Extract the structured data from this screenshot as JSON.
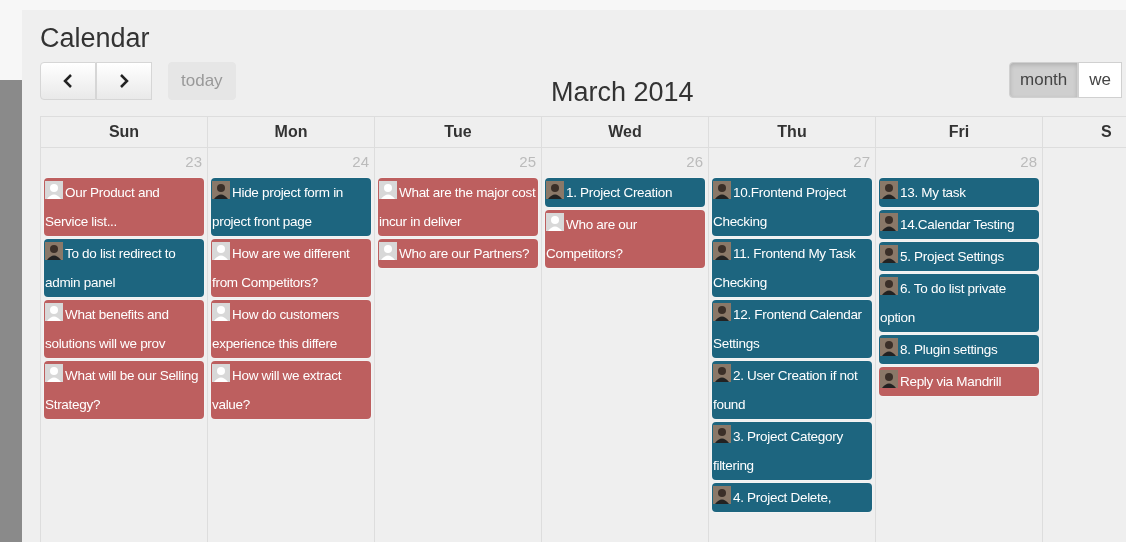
{
  "page": {
    "title": "Calendar"
  },
  "toolbar": {
    "today": "today",
    "title": "March 2014",
    "views": [
      {
        "label": "month",
        "selected": true
      },
      {
        "label": "we",
        "selected": false
      }
    ]
  },
  "days": [
    {
      "name": "Sun",
      "number": "23",
      "events": [
        {
          "text": "Our Product and Service list...",
          "color": "#bd5f5f",
          "kind": "generic"
        },
        {
          "text": "To do list redirect to admin panel",
          "color": "#1d657f",
          "kind": "photo"
        },
        {
          "text": "What benefits and solutions will we prov",
          "color": "#bd5f5f",
          "kind": "generic"
        },
        {
          "text": "What will be our Selling Strategy?",
          "color": "#bd5f5f",
          "kind": "generic"
        }
      ]
    },
    {
      "name": "Mon",
      "number": "24",
      "events": [
        {
          "text": "Hide project form in project front page",
          "color": "#1d657f",
          "kind": "photo"
        },
        {
          "text": "How are we different from Competitors?",
          "color": "#bd5f5f",
          "kind": "generic"
        },
        {
          "text": "How do customers experience this differe",
          "color": "#bd5f5f",
          "kind": "generic"
        },
        {
          "text": "How will we extract value?",
          "color": "#bd5f5f",
          "kind": "generic"
        }
      ]
    },
    {
      "name": "Tue",
      "number": "25",
      "events": [
        {
          "text": "What are the major cost incur in deliver",
          "color": "#bd5f5f",
          "kind": "generic"
        },
        {
          "text": "Who are our Partners?",
          "color": "#bd5f5f",
          "kind": "generic"
        }
      ]
    },
    {
      "name": "Wed",
      "number": "26",
      "events": [
        {
          "text": "1. Project Creation",
          "color": "#1d657f",
          "kind": "photo"
        },
        {
          "text": "Who are our Competitors?",
          "color": "#bd5f5f",
          "kind": "generic"
        }
      ]
    },
    {
      "name": "Thu",
      "number": "27",
      "events": [
        {
          "text": "10.Frontend Project Checking",
          "color": "#1d657f",
          "kind": "photo"
        },
        {
          "text": "11. Frontend My Task Checking",
          "color": "#1d657f",
          "kind": "photo"
        },
        {
          "text": "12. Frontend Calendar Settings",
          "color": "#1d657f",
          "kind": "photo"
        },
        {
          "text": "2. User Creation if not found",
          "color": "#1d657f",
          "kind": "photo"
        },
        {
          "text": "3. Project Category filtering",
          "color": "#1d657f",
          "kind": "photo"
        },
        {
          "text": "4. Project Delete,",
          "color": "#1d657f",
          "kind": "photo"
        }
      ]
    },
    {
      "name": "Fri",
      "number": "28",
      "events": [
        {
          "text": "13. My task",
          "color": "#1d657f",
          "kind": "photo"
        },
        {
          "text": "14.Calendar Testing",
          "color": "#1d657f",
          "kind": "photo"
        },
        {
          "text": "5. Project Settings",
          "color": "#1d657f",
          "kind": "photo"
        },
        {
          "text": "6. To do list private option",
          "color": "#1d657f",
          "kind": "photo"
        },
        {
          "text": "8. Plugin settings",
          "color": "#1d657f",
          "kind": "photo"
        },
        {
          "text": "Reply via Mandrill",
          "color": "#bd5f5f",
          "kind": "photo"
        }
      ]
    },
    {
      "name": "S"
    }
  ]
}
